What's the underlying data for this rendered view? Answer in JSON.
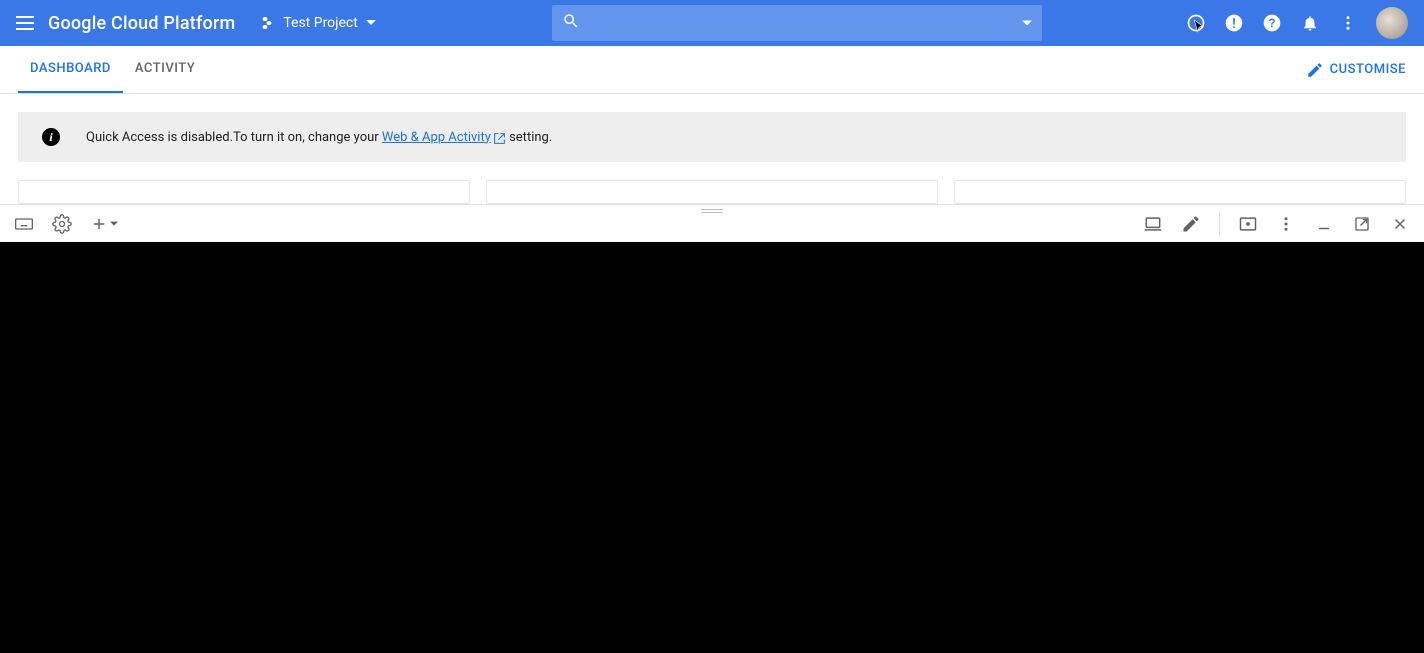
{
  "header": {
    "product_name": "Google Cloud Platform",
    "project_name": "Test Project"
  },
  "tabs": {
    "dashboard": "DASHBOARD",
    "activity": "ACTIVITY",
    "customise": "CUSTOMISE"
  },
  "banner": {
    "prefix": "Quick Access is disabled.To turn it on, change your ",
    "link": "Web & App Activity",
    "suffix": "  setting."
  },
  "colors": {
    "header_bg": "#3b78e7",
    "accent": "#1a73e8"
  }
}
